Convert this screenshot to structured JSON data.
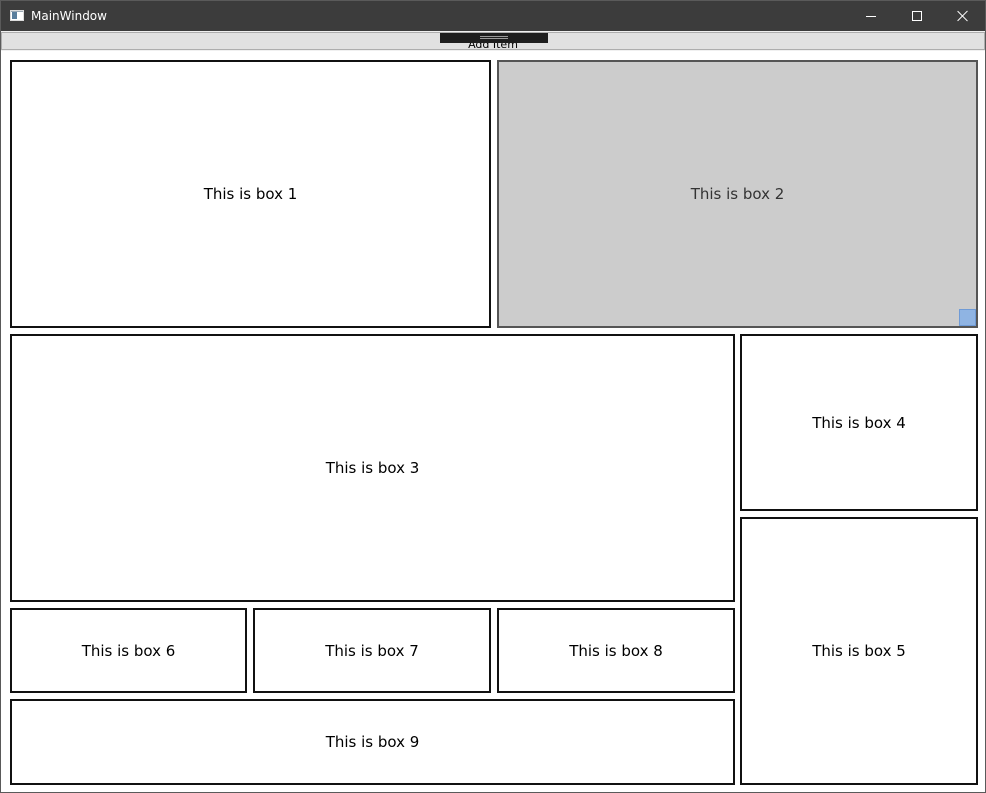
{
  "window": {
    "title": "MainWindow",
    "icon": "app-window-icon",
    "controls": {
      "minimize_icon": "minimize-icon",
      "maximize_icon": "maximize-icon",
      "close_icon": "close-icon"
    }
  },
  "toolbar": {
    "add_item_label": "Add Item"
  },
  "boxes": [
    {
      "label": "This is box 1",
      "selected": false
    },
    {
      "label": "This is box 2",
      "selected": true
    },
    {
      "label": "This is box 3",
      "selected": false
    },
    {
      "label": "This is box 4",
      "selected": false
    },
    {
      "label": "This is box 5",
      "selected": false
    },
    {
      "label": "This is box 6",
      "selected": false
    },
    {
      "label": "This is box 7",
      "selected": false
    },
    {
      "label": "This is box 8",
      "selected": false
    },
    {
      "label": "This is box 9",
      "selected": false
    }
  ],
  "colors": {
    "titlebar": "#3c3c3c",
    "selected_box": "#cccccc",
    "resize_grip": "#8fb4e3",
    "box_border": "#111111"
  }
}
